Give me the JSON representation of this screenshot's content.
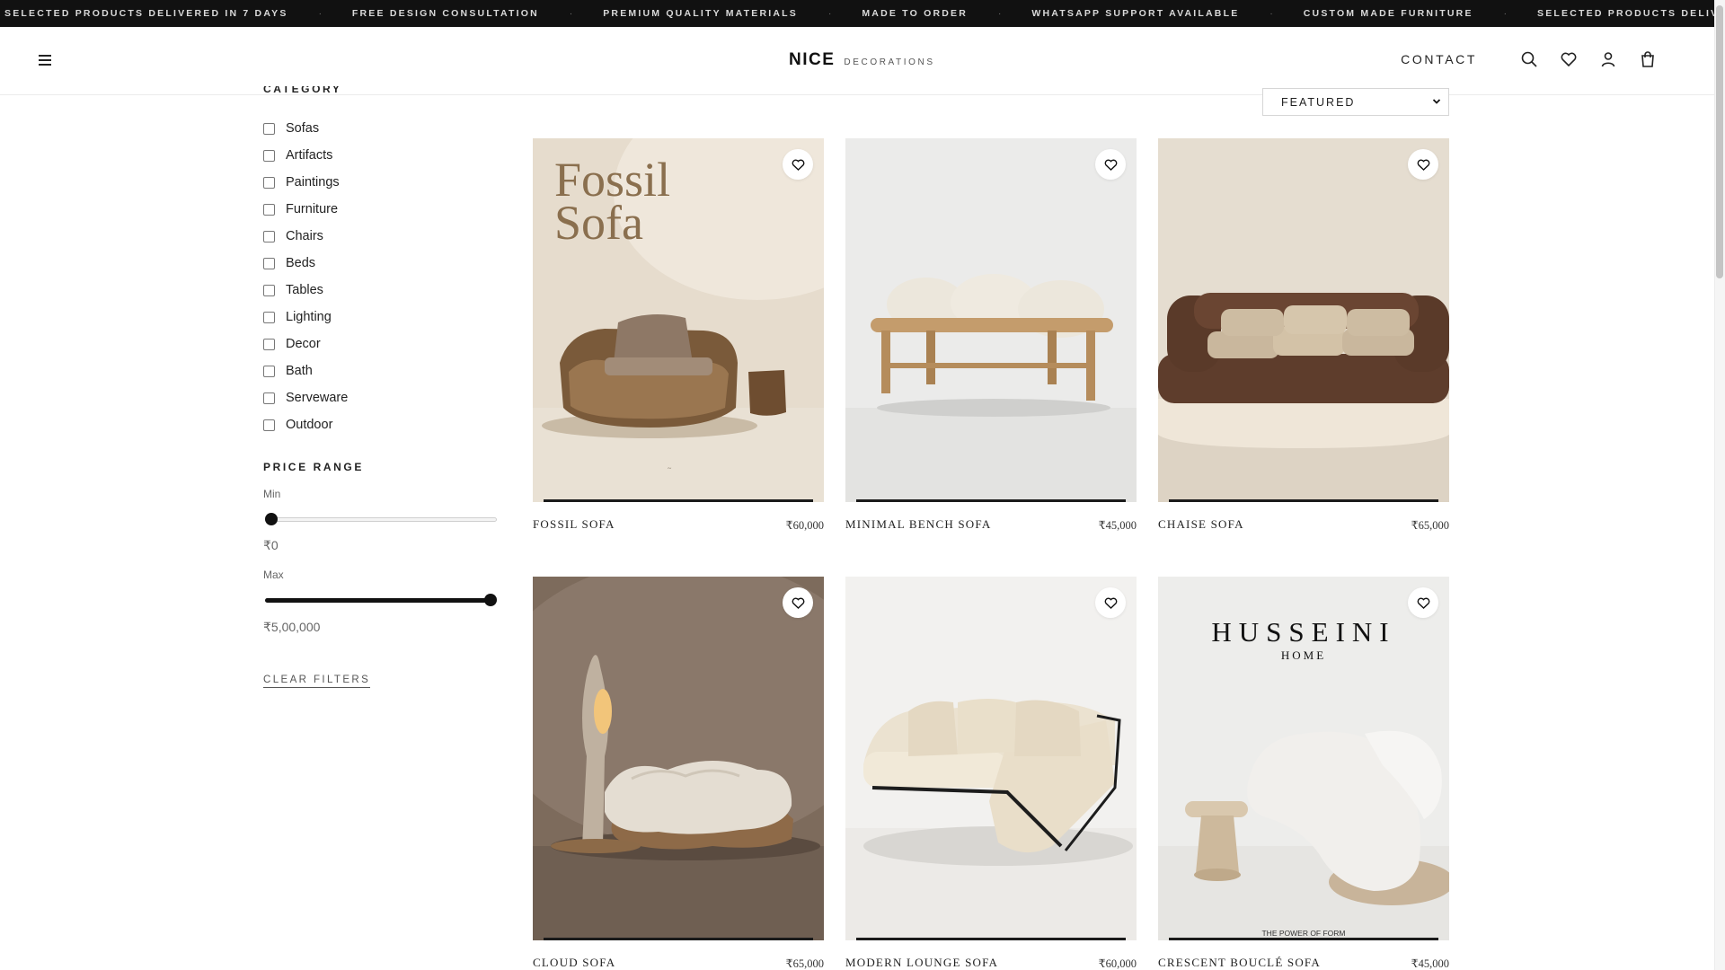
{
  "marquee": {
    "items": [
      "Selected products delivered in 7 days",
      "Free design consultation",
      "Premium quality materials",
      "Made to order",
      "WhatsApp support available",
      "Custom made furniture",
      "Selected products delivered in 7 days"
    ],
    "separator": "·"
  },
  "header": {
    "logo_main": "NICE",
    "logo_sub": "DECORATIONS",
    "contact_label": "CONTACT",
    "icons": [
      "menu-icon",
      "search-icon",
      "heart-icon",
      "user-icon",
      "cart-icon"
    ]
  },
  "sidebar": {
    "category_heading": "CATEGORY",
    "categories": [
      {
        "label": "Sofas",
        "checked": false
      },
      {
        "label": "Artifacts",
        "checked": false
      },
      {
        "label": "Paintings",
        "checked": false
      },
      {
        "label": "Furniture",
        "checked": false
      },
      {
        "label": "Chairs",
        "checked": false
      },
      {
        "label": "Beds",
        "checked": false
      },
      {
        "label": "Tables",
        "checked": false
      },
      {
        "label": "Lighting",
        "checked": false
      },
      {
        "label": "Decor",
        "checked": false
      },
      {
        "label": "Bath",
        "checked": false
      },
      {
        "label": "Serveware",
        "checked": false
      },
      {
        "label": "Outdoor",
        "checked": false
      }
    ],
    "price_heading": "PRICE RANGE",
    "min_label": "Min",
    "min_value": "₹0",
    "min_fraction": 0,
    "max_label": "Max",
    "max_value": "₹5,00,000",
    "max_fraction": 1,
    "clear_label": "CLEAR FILTERS"
  },
  "sort": {
    "selected": "FEATURED"
  },
  "products": [
    {
      "name": "Fossil Sofa",
      "price": "₹60,000",
      "image_text": "Fossil\nSofa",
      "image_style": "fossil"
    },
    {
      "name": "Minimal Bench Sofa",
      "price": "₹45,000",
      "image_style": "bench"
    },
    {
      "name": "Chaise Sofa",
      "price": "₹65,000",
      "image_style": "chaise"
    },
    {
      "name": "Cloud Sofa",
      "price": "₹65,000",
      "image_style": "cloud"
    },
    {
      "name": "Modern Lounge Sofa",
      "price": "₹60,000",
      "image_style": "lounge"
    },
    {
      "name": "Crescent Bouclé Sofa",
      "price": "₹45,000",
      "image_style": "crescent",
      "image_brand": "HUSSEINI",
      "image_brand_sub": "HOME",
      "image_tagline": "THE POWER OF FORM"
    }
  ],
  "colors": {
    "marquee_bg": "#111111",
    "accent": "#111111",
    "card_fossil_bg": "#e6dccd",
    "card_bench_bg": "#ebebea",
    "card_chaise_bg": "#e5ddd0",
    "card_cloud_bg": "#7d6b5c",
    "card_lounge_bg": "#f2f1ef",
    "card_crescent_bg": "#ededeb"
  }
}
